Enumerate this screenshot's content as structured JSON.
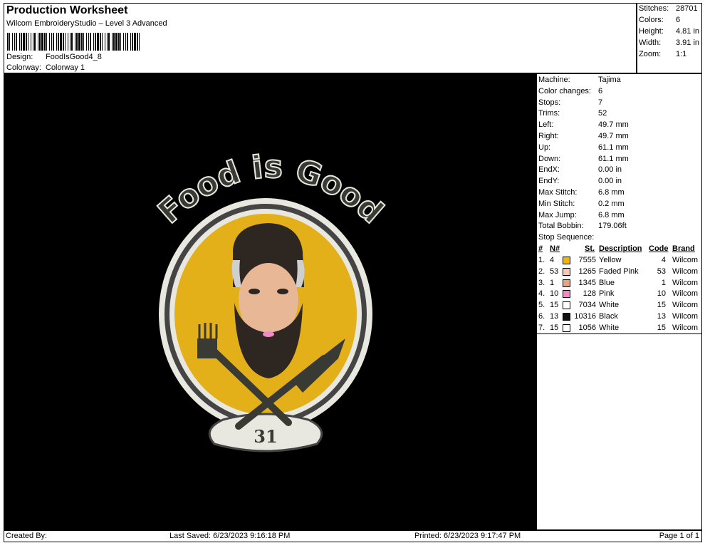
{
  "header": {
    "title": "Production Worksheet",
    "subtitle": "Wilcom EmbroideryStudio – Level 3 Advanced",
    "design_label": "Design:",
    "design_value": "FoodIsGood4_8",
    "colorway_label": "Colorway:",
    "colorway_value": "Colorway 1"
  },
  "stats": [
    {
      "label": "Stitches:",
      "value": "28701"
    },
    {
      "label": "Colors:",
      "value": "6"
    },
    {
      "label": "Height:",
      "value": "4.81 in"
    },
    {
      "label": "Width:",
      "value": "3.91 in"
    },
    {
      "label": "Zoom:",
      "value": "1:1"
    }
  ],
  "design_text": {
    "top": "Food is Good",
    "number": "31"
  },
  "info": [
    {
      "label": "Machine:",
      "value": "Tajima"
    },
    {
      "label": "Color changes:",
      "value": "6"
    },
    {
      "label": "Stops:",
      "value": "7"
    },
    {
      "label": "Trims:",
      "value": "52"
    },
    {
      "label": "Left:",
      "value": "49.7 mm"
    },
    {
      "label": "Right:",
      "value": "49.7 mm"
    },
    {
      "label": "Up:",
      "value": "61.1 mm"
    },
    {
      "label": "Down:",
      "value": "61.1 mm"
    },
    {
      "label": "EndX:",
      "value": "0.00 in"
    },
    {
      "label": "EndY:",
      "value": "0.00 in"
    },
    {
      "label": "Max Stitch:",
      "value": "6.8 mm"
    },
    {
      "label": "Min Stitch:",
      "value": "0.2 mm"
    },
    {
      "label": "Max Jump:",
      "value": "6.8 mm"
    },
    {
      "label": "Total Bobbin:",
      "value": "179.06ft"
    }
  ],
  "stop_sequence": {
    "title": "Stop Sequence:",
    "headers": {
      "num": "#",
      "n": "N#",
      "st": "St.",
      "desc": "Description",
      "code": "Code",
      "brand": "Brand"
    },
    "rows": [
      {
        "num": "1.",
        "n": "4",
        "color": "#f2b705",
        "st": "7555",
        "desc": "Yellow",
        "code": "4",
        "brand": "Wilcom"
      },
      {
        "num": "2.",
        "n": "53",
        "color": "#f6c9b4",
        "st": "1265",
        "desc": "Faded Pink",
        "code": "53",
        "brand": "Wilcom"
      },
      {
        "num": "3.",
        "n": "1",
        "color": "#e9a47f",
        "st": "1345",
        "desc": "Blue",
        "code": "1",
        "brand": "Wilcom"
      },
      {
        "num": "4.",
        "n": "10",
        "color": "#f08ac6",
        "st": "128",
        "desc": "Pink",
        "code": "10",
        "brand": "Wilcom"
      },
      {
        "num": "5.",
        "n": "15",
        "color": "#ffffff",
        "st": "7034",
        "desc": "White",
        "code": "15",
        "brand": "Wilcom"
      },
      {
        "num": "6.",
        "n": "13",
        "color": "#111111",
        "st": "10316",
        "desc": "Black",
        "code": "13",
        "brand": "Wilcom"
      },
      {
        "num": "7.",
        "n": "15",
        "color": "#ffffff",
        "st": "1056",
        "desc": "White",
        "code": "15",
        "brand": "Wilcom"
      }
    ]
  },
  "footer": {
    "created": "Created By:",
    "saved": "Last Saved: 6/23/2023 9:16:18 PM",
    "printed": "Printed: 6/23/2023 9:17:47 PM",
    "page": "Page 1 of 1"
  }
}
